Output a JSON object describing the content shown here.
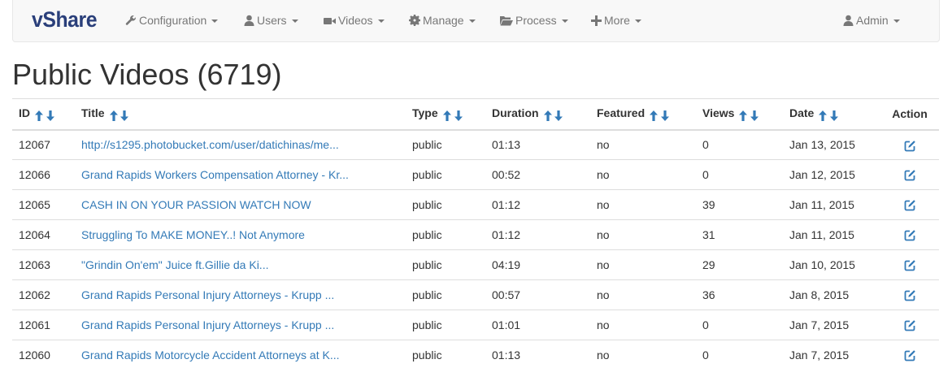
{
  "brand": "vShare",
  "nav": {
    "configuration": "Configuration",
    "users": "Users",
    "videos": "Videos",
    "manage": "Manage",
    "process": "Process",
    "more": "More",
    "admin": "Admin"
  },
  "page_title": "Public Videos (6719)",
  "table": {
    "columns": [
      "ID",
      "Title",
      "Type",
      "Duration",
      "Featured",
      "Views",
      "Date",
      "Action"
    ],
    "rows": [
      {
        "id": "12067",
        "title": "http://s1295.photobucket.com/user/datichinas/me...",
        "type": "public",
        "duration": "01:13",
        "featured": "no",
        "views": "0",
        "date": "Jan 13, 2015"
      },
      {
        "id": "12066",
        "title": "Grand Rapids Workers Compensation Attorney - Kr...",
        "type": "public",
        "duration": "00:52",
        "featured": "no",
        "views": "0",
        "date": "Jan 12, 2015"
      },
      {
        "id": "12065",
        "title": "CASH IN ON YOUR PASSION WATCH NOW",
        "type": "public",
        "duration": "01:12",
        "featured": "no",
        "views": "39",
        "date": "Jan 11, 2015"
      },
      {
        "id": "12064",
        "title": "Struggling To MAKE MONEY..! Not Anymore",
        "type": "public",
        "duration": "01:12",
        "featured": "no",
        "views": "31",
        "date": "Jan 11, 2015"
      },
      {
        "id": "12063",
        "title": "\"Grindin On'em\" Juice ft.Gillie da Ki...",
        "type": "public",
        "duration": "04:19",
        "featured": "no",
        "views": "29",
        "date": "Jan 10, 2015"
      },
      {
        "id": "12062",
        "title": "Grand Rapids Personal Injury Attorneys - Krupp ...",
        "type": "public",
        "duration": "00:57",
        "featured": "no",
        "views": "36",
        "date": "Jan 8, 2015"
      },
      {
        "id": "12061",
        "title": "Grand Rapids Personal Injury Attorneys - Krupp ...",
        "type": "public",
        "duration": "01:01",
        "featured": "no",
        "views": "0",
        "date": "Jan 7, 2015"
      },
      {
        "id": "12060",
        "title": "Grand Rapids Motorcycle Accident Attorneys at K...",
        "type": "public",
        "duration": "01:13",
        "featured": "no",
        "views": "0",
        "date": "Jan 7, 2015"
      }
    ]
  },
  "icons": {
    "configuration": "wrench-icon",
    "users": "user-icon",
    "videos": "video-camera-icon",
    "manage": "gear-icon",
    "process": "folder-open-icon",
    "more": "plus-icon",
    "admin": "user-icon",
    "sort_up": "arrow-up-icon",
    "sort_down": "arrow-down-icon",
    "edit": "edit-icon"
  },
  "colors": {
    "brand": "#2a3f7a",
    "link": "#337ab7",
    "nav_text": "#777777",
    "navbar_bg": "#f8f8f8"
  }
}
